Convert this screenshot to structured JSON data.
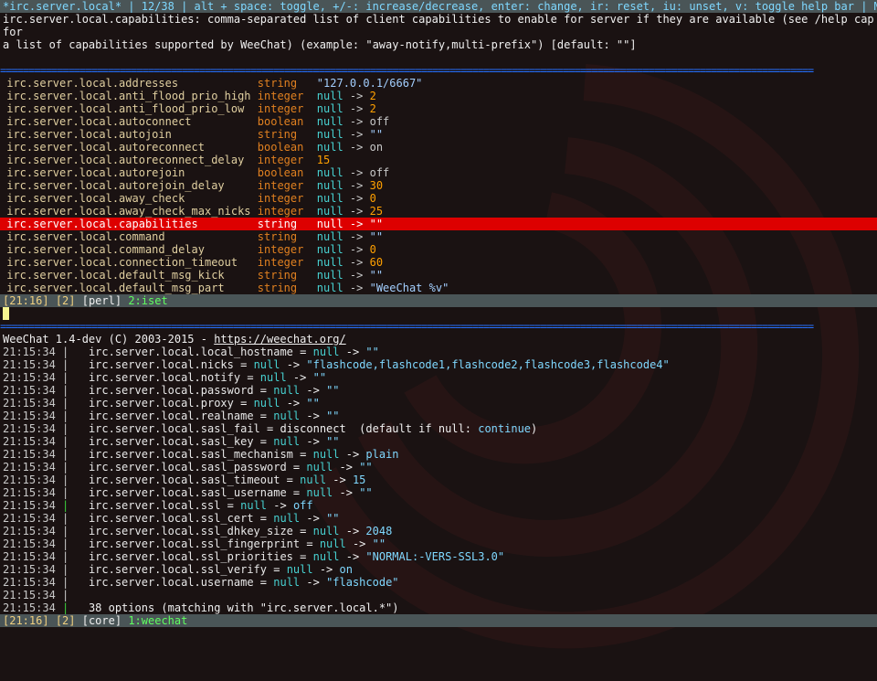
{
  "titlebar": {
    "prefix": "*irc.server.local* | 12/38 | alt + space: toggle, +/-: increase/decrease, enter: change, ir: reset, iu: unset, v: toggle help bar | Mo",
    "more": ">>"
  },
  "help": {
    "line1": "irc.server.local.capabilities: comma-separated list of client capabilities to enable for server if they are available (see /help cap for",
    "line2": " a list of capabilities supported by WeeChat) (example: \"away-notify,multi-prefix\") [default: \"\"]"
  },
  "options_cols": {
    "key_w": 38,
    "type_w": 9
  },
  "options": [
    {
      "key": "irc.server.local.addresses",
      "type": "string",
      "direct": "\"127.0.0.1/6667\""
    },
    {
      "key": "irc.server.local.anti_flood_prio_high",
      "type": "integer",
      "null": true,
      "value": "2",
      "vclass": "int"
    },
    {
      "key": "irc.server.local.anti_flood_prio_low",
      "type": "integer",
      "null": true,
      "value": "2",
      "vclass": "int"
    },
    {
      "key": "irc.server.local.autoconnect",
      "type": "boolean",
      "null": true,
      "value": "off",
      "vclass": "bool"
    },
    {
      "key": "irc.server.local.autojoin",
      "type": "string",
      "null": true,
      "value": "\"\"",
      "vclass": "str"
    },
    {
      "key": "irc.server.local.autoreconnect",
      "type": "boolean",
      "null": true,
      "value": "on",
      "vclass": "bool"
    },
    {
      "key": "irc.server.local.autoreconnect_delay",
      "type": "integer",
      "direct": "15",
      "dclass": "int"
    },
    {
      "key": "irc.server.local.autorejoin",
      "type": "boolean",
      "null": true,
      "value": "off",
      "vclass": "bool"
    },
    {
      "key": "irc.server.local.autorejoin_delay",
      "type": "integer",
      "null": true,
      "value": "30",
      "vclass": "int"
    },
    {
      "key": "irc.server.local.away_check",
      "type": "integer",
      "null": true,
      "value": "0",
      "vclass": "int"
    },
    {
      "key": "irc.server.local.away_check_max_nicks",
      "type": "integer",
      "null": true,
      "value": "25",
      "vclass": "int"
    },
    {
      "key": "irc.server.local.capabilities",
      "type": "string",
      "null": true,
      "value": "\"\"",
      "vclass": "str",
      "selected": true
    },
    {
      "key": "irc.server.local.command",
      "type": "string",
      "null": true,
      "value": "\"\"",
      "vclass": "str"
    },
    {
      "key": "irc.server.local.command_delay",
      "type": "integer",
      "null": true,
      "value": "0",
      "vclass": "int"
    },
    {
      "key": "irc.server.local.connection_timeout",
      "type": "integer",
      "null": true,
      "value": "60",
      "vclass": "int"
    },
    {
      "key": "irc.server.local.default_msg_kick",
      "type": "string",
      "null": true,
      "value": "\"\"",
      "vclass": "str"
    },
    {
      "key": "irc.server.local.default_msg_part",
      "type": "string",
      "null": true,
      "value": "\"WeeChat %v\"",
      "vclass": "str"
    }
  ],
  "status_top": {
    "time": "[21:16]",
    "buf": "[2]",
    "plugin": "[perl]",
    "name_pre": "2:",
    "name": "iset"
  },
  "banner": {
    "prefix": "WeeChat 1.4-dev (C) 2003-2015 - ",
    "url": "https://weechat.org/"
  },
  "log": [
    {
      "ts": "21:15:34",
      "pipe": "w",
      "opt": "irc.server.local.local_hostname",
      "eq": " = ",
      "n": "null",
      "arr": " -> ",
      "val": "\"\""
    },
    {
      "ts": "21:15:34",
      "pipe": "w",
      "opt": "irc.server.local.nicks",
      "eq": " = ",
      "n": "null",
      "arr": " -> ",
      "val": "\"flashcode,flashcode1,flashcode2,flashcode3,flashcode4\""
    },
    {
      "ts": "21:15:34",
      "pipe": "w",
      "opt": "irc.server.local.notify",
      "eq": " = ",
      "n": "null",
      "arr": " -> ",
      "val": "\"\""
    },
    {
      "ts": "21:15:34",
      "pipe": "w",
      "opt": "irc.server.local.password",
      "eq": " = ",
      "n": "null",
      "arr": " -> ",
      "val": "\"\""
    },
    {
      "ts": "21:15:34",
      "pipe": "w",
      "opt": "irc.server.local.proxy",
      "eq": " = ",
      "n": "null",
      "arr": " -> ",
      "val": "\"\""
    },
    {
      "ts": "21:15:34",
      "pipe": "w",
      "opt": "irc.server.local.realname",
      "eq": " = ",
      "n": "null",
      "arr": " -> ",
      "val": "\"\""
    },
    {
      "ts": "21:15:34",
      "pipe": "w",
      "opt": "irc.server.local.sasl_fail",
      "eq": " = ",
      "raw_after_eq": "disconnect  (default if null: ",
      "raw_tail": "continue",
      "raw_close": ")"
    },
    {
      "ts": "21:15:34",
      "pipe": "w",
      "opt": "irc.server.local.sasl_key",
      "eq": " = ",
      "n": "null",
      "arr": " -> ",
      "val": "\"\""
    },
    {
      "ts": "21:15:34",
      "pipe": "w",
      "opt": "irc.server.local.sasl_mechanism",
      "eq": " = ",
      "n": "null",
      "arr": " -> ",
      "val": "plain"
    },
    {
      "ts": "21:15:34",
      "pipe": "w",
      "opt": "irc.server.local.sasl_password",
      "eq": " = ",
      "n": "null",
      "arr": " -> ",
      "val": "\"\""
    },
    {
      "ts": "21:15:34",
      "pipe": "w",
      "opt": "irc.server.local.sasl_timeout",
      "eq": " = ",
      "n": "null",
      "arr": " -> ",
      "val": "15"
    },
    {
      "ts": "21:15:34",
      "pipe": "w",
      "opt": "irc.server.local.sasl_username",
      "eq": " = ",
      "n": "null",
      "arr": " -> ",
      "val": "\"\""
    },
    {
      "ts": "21:15:34",
      "pipe": "g",
      "opt": "irc.server.local.ssl",
      "eq": " = ",
      "n": "null",
      "arr": " -> ",
      "val": "off"
    },
    {
      "ts": "21:15:34",
      "pipe": "w",
      "opt": "irc.server.local.ssl_cert",
      "eq": " = ",
      "n": "null",
      "arr": " -> ",
      "val": "\"\""
    },
    {
      "ts": "21:15:34",
      "pipe": "w",
      "opt": "irc.server.local.ssl_dhkey_size",
      "eq": " = ",
      "n": "null",
      "arr": " -> ",
      "val": "2048"
    },
    {
      "ts": "21:15:34",
      "pipe": "w",
      "opt": "irc.server.local.ssl_fingerprint",
      "eq": " = ",
      "n": "null",
      "arr": " -> ",
      "val": "\"\""
    },
    {
      "ts": "21:15:34",
      "pipe": "w",
      "opt": "irc.server.local.ssl_priorities",
      "eq": " = ",
      "n": "null",
      "arr": " -> ",
      "val": "\"NORMAL:-VERS-SSL3.0\""
    },
    {
      "ts": "21:15:34",
      "pipe": "w",
      "opt": "irc.server.local.ssl_verify",
      "eq": " = ",
      "n": "null",
      "arr": " -> ",
      "val": "on"
    },
    {
      "ts": "21:15:34",
      "pipe": "w",
      "opt": "irc.server.local.username",
      "eq": " = ",
      "n": "null",
      "arr": " -> ",
      "val": "\"flashcode\""
    },
    {
      "ts": "21:15:34",
      "pipe": "w"
    },
    {
      "ts": "21:15:34",
      "pipe": "g",
      "summary": "38 options (matching with \"irc.server.local.*\")"
    }
  ],
  "status_bottom": {
    "time": "[21:16]",
    "buf": "[2]",
    "plugin": "[core]",
    "name_pre": "1:",
    "name": "weechat"
  }
}
